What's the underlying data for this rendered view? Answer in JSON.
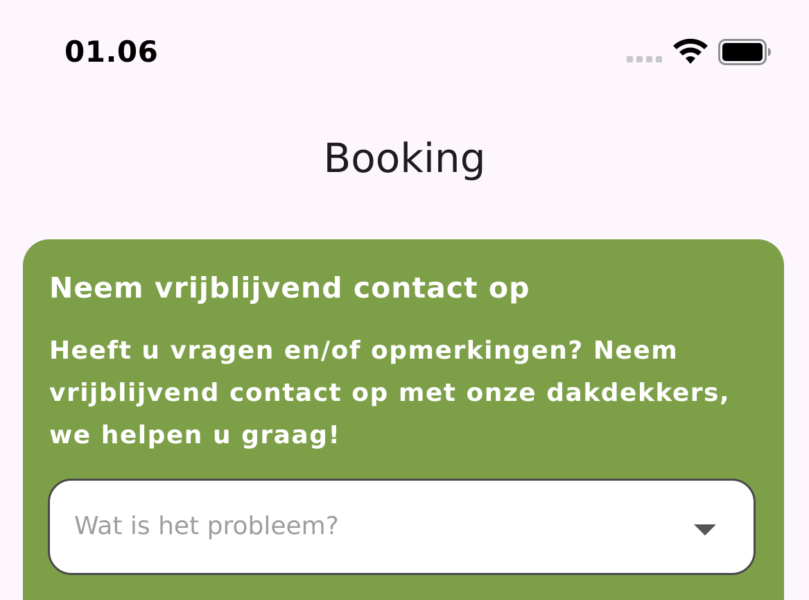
{
  "status_bar": {
    "time": "01.06",
    "icons": [
      "signal-icon",
      "wifi-icon",
      "battery-icon"
    ]
  },
  "header": {
    "title": "Booking"
  },
  "card": {
    "title": "Neem vrijblijvend contact op",
    "text": "Heeft u vragen en/of opmerkingen? Neem vrijblijvend contact op met onze dakdekkers, we helpen u graag!",
    "dropdown": {
      "placeholder": "Wat is het probleem?",
      "icon": "chevron-down-icon"
    }
  },
  "colors": {
    "background": "#fdf7fd",
    "card": "#7d9f48",
    "card_text": "#ffffff",
    "placeholder": "#9e9e9e"
  }
}
